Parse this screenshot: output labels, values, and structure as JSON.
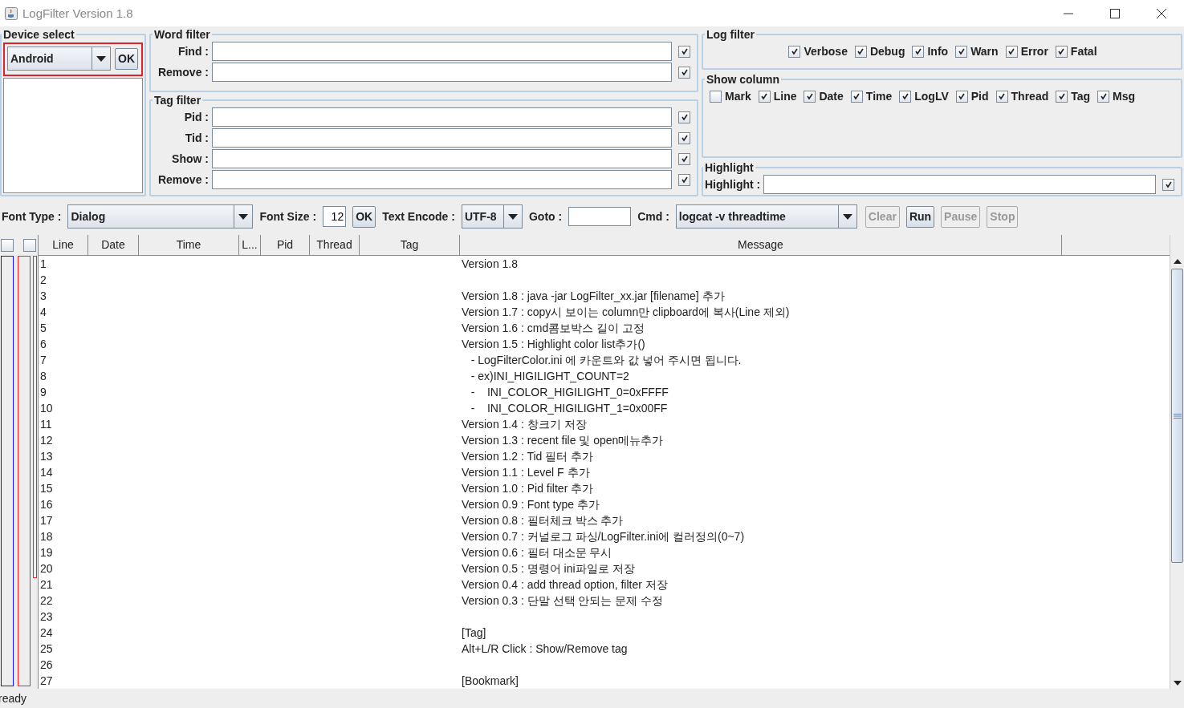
{
  "window": {
    "title": "LogFilter Version 1.8"
  },
  "device_select": {
    "title": "Device select",
    "device": "Android",
    "ok_button": "OK"
  },
  "word_filter": {
    "title": "Word filter",
    "fields": [
      {
        "label": "Find :",
        "checked": true
      },
      {
        "label": "Remove :",
        "checked": true
      }
    ]
  },
  "tag_filter": {
    "title": "Tag filter",
    "fields": [
      {
        "label": "Pid :",
        "checked": true
      },
      {
        "label": "Tid :",
        "checked": true
      },
      {
        "label": "Show :",
        "checked": true
      },
      {
        "label": "Remove :",
        "checked": true
      }
    ]
  },
  "log_filter": {
    "title": "Log filter",
    "levels": [
      {
        "label": "Verbose",
        "checked": true
      },
      {
        "label": "Debug",
        "checked": true
      },
      {
        "label": "Info",
        "checked": true
      },
      {
        "label": "Warn",
        "checked": true
      },
      {
        "label": "Error",
        "checked": true
      },
      {
        "label": "Fatal",
        "checked": true
      }
    ]
  },
  "show_column": {
    "title": "Show column",
    "columns": [
      {
        "label": "Mark",
        "checked": false
      },
      {
        "label": "Line",
        "checked": true
      },
      {
        "label": "Date",
        "checked": true
      },
      {
        "label": "Time",
        "checked": true
      },
      {
        "label": "LogLV",
        "checked": true
      },
      {
        "label": "Pid",
        "checked": true
      },
      {
        "label": "Thread",
        "checked": true
      },
      {
        "label": "Tag",
        "checked": true
      },
      {
        "label": "Msg",
        "checked": true
      }
    ]
  },
  "highlight": {
    "title": "Highlight",
    "label": "Highlight :",
    "checked": true
  },
  "toolbar": {
    "font_type": {
      "label": "Font Type :",
      "value": "Dialog"
    },
    "font_size": {
      "label": "Font Size :",
      "value": "12",
      "ok_button": "OK"
    },
    "text_encode": {
      "label": "Text Encode :",
      "value": "UTF-8"
    },
    "goto": {
      "label": "Goto :"
    },
    "cmd": {
      "label": "Cmd :",
      "value": "logcat -v threadtime"
    },
    "buttons": [
      {
        "label": "Clear",
        "disabled": true
      },
      {
        "label": "Run",
        "disabled": false
      },
      {
        "label": "Pause",
        "disabled": true
      },
      {
        "label": "Stop",
        "disabled": true
      }
    ]
  },
  "bookmark_checks": [
    {
      "checked": false
    },
    {
      "checked": false
    }
  ],
  "table": {
    "columns": [
      "Line",
      "Date",
      "Time",
      "L...",
      "Pid",
      "Thread",
      "Tag",
      "Message"
    ],
    "rows": [
      {
        "line": "1",
        "message": "Version 1.8"
      },
      {
        "line": "2"
      },
      {
        "line": "3",
        "message": "Version 1.8 : java -jar LogFilter_xx.jar [filename] 추가"
      },
      {
        "line": "4",
        "message": "Version 1.7 : copy시 보이는 column만 clipboard에 복사(Line 제외)"
      },
      {
        "line": "5",
        "message": "Version 1.6 : cmd콤보박스 길이 고정"
      },
      {
        "line": "6",
        "message": "Version 1.5 : Highlight color list추가()"
      },
      {
        "line": "7",
        "message": "   - LogFilterColor.ini 에 카운트와 값 넣어 주시면 됩니다."
      },
      {
        "line": "8",
        "message": "   - ex)INI_HIGILIGHT_COUNT=2"
      },
      {
        "line": "9",
        "message": "   -    INI_COLOR_HIGILIGHT_0=0xFFFF"
      },
      {
        "line": "10",
        "message": "   -    INI_COLOR_HIGILIGHT_1=0x00FF"
      },
      {
        "line": "11",
        "message": "Version 1.4 : 창크기 저장"
      },
      {
        "line": "12",
        "message": "Version 1.3 : recent file 및 open메뉴추가"
      },
      {
        "line": "13",
        "message": "Version 1.2 : Tid 필터 추가"
      },
      {
        "line": "14",
        "message": "Version 1.1 : Level F 추가"
      },
      {
        "line": "15",
        "message": "Version 1.0 : Pid filter 추가"
      },
      {
        "line": "16",
        "message": "Version 0.9 : Font type 추가"
      },
      {
        "line": "17",
        "message": "Version 0.8 : 필터체크 박스 추가"
      },
      {
        "line": "18",
        "message": "Version 0.7 : 커널로그 파싱/LogFilter.ini에 컬러정의(0~7)"
      },
      {
        "line": "19",
        "message": "Version 0.6 : 필터 대소문 무시"
      },
      {
        "line": "20",
        "message": "Version 0.5 : 명령어 ini파일로 저장"
      },
      {
        "line": "21",
        "message": "Version 0.4 : add thread option, filter 저장"
      },
      {
        "line": "22",
        "message": "Version 0.3 : 단말 선택 안되는 문제 수정"
      },
      {
        "line": "23"
      },
      {
        "line": "24",
        "message": "[Tag]"
      },
      {
        "line": "25",
        "message": "Alt+L/R Click : Show/Remove tag"
      },
      {
        "line": "26"
      },
      {
        "line": "27",
        "message": "[Bookmark]"
      }
    ]
  },
  "status_bar": "ready"
}
